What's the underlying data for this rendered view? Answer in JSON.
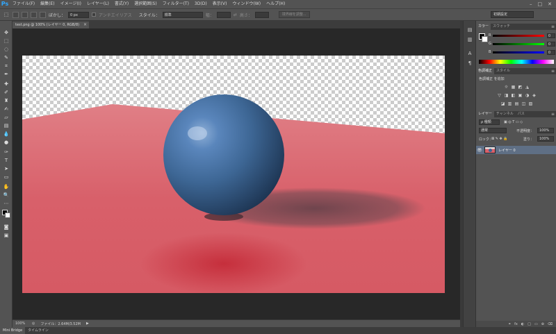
{
  "app": {
    "logo": "Ps",
    "menu": [
      "ファイル(F)",
      "編集(E)",
      "イメージ(I)",
      "レイヤー(L)",
      "書式(Y)",
      "選択範囲(S)",
      "フィルター(T)",
      "3D(D)",
      "表示(V)",
      "ウィンドウ(W)",
      "ヘルプ(H)"
    ],
    "window_controls": [
      "–",
      "□",
      "✕"
    ]
  },
  "options": {
    "feather_label": "ぼかし：",
    "feather_value": "0 px",
    "antialias_label": "アンチエイリアス",
    "style_label": "スタイル：",
    "style_value": "標準",
    "width_label": "幅：",
    "height_label": "高さ：",
    "refine_button": "境界線を調整...",
    "workspace": "初期設定"
  },
  "document": {
    "tab_title": "test.png @ 100% (レイヤー 0, RGB/8)",
    "tab_close": "×",
    "zoom": "100%",
    "file_info": "ファイル：2.64M/3.52M"
  },
  "bottom_tabs": [
    "Mini Bridge",
    "タイムライン"
  ],
  "color_panel": {
    "tabs": [
      "カラー",
      "スウォッチ"
    ],
    "sliders": [
      {
        "label": "R",
        "value": "0",
        "color": "#e03030"
      },
      {
        "label": "G",
        "value": "0",
        "color": "#30c030"
      },
      {
        "label": "B",
        "value": "0",
        "color": "#3050e0"
      }
    ]
  },
  "adjust_panel": {
    "tabs": [
      "色調補正",
      "スタイル"
    ],
    "title": "色調補正 を追加",
    "icons_row1": [
      "☼",
      "▦",
      "◩",
      "◮"
    ],
    "icons_row2": [
      "▽",
      "◨",
      "◧",
      "▣",
      "◑",
      "◈"
    ],
    "icons_row3": [
      "◪",
      "▥",
      "▤",
      "◫",
      "▧"
    ]
  },
  "layers_panel": {
    "tabs": [
      "レイヤー",
      "チャンネル",
      "パス"
    ],
    "filter_label": "ρ 種類",
    "blend_mode": "通常",
    "opacity_label": "不透明度：",
    "opacity_value": "100%",
    "lock_label": "ロック：",
    "fill_label": "塗り：",
    "fill_value": "100%",
    "layers": [
      {
        "name": "レイヤー 0",
        "visible": true
      }
    ],
    "footer_icons": [
      "fx",
      "◐",
      "□",
      "▭",
      "⊕",
      "⌫"
    ]
  },
  "artwork": {
    "floor_color": "#d8606a",
    "ball_color": "#3d6694",
    "shadow_color": "#6e4a52"
  }
}
